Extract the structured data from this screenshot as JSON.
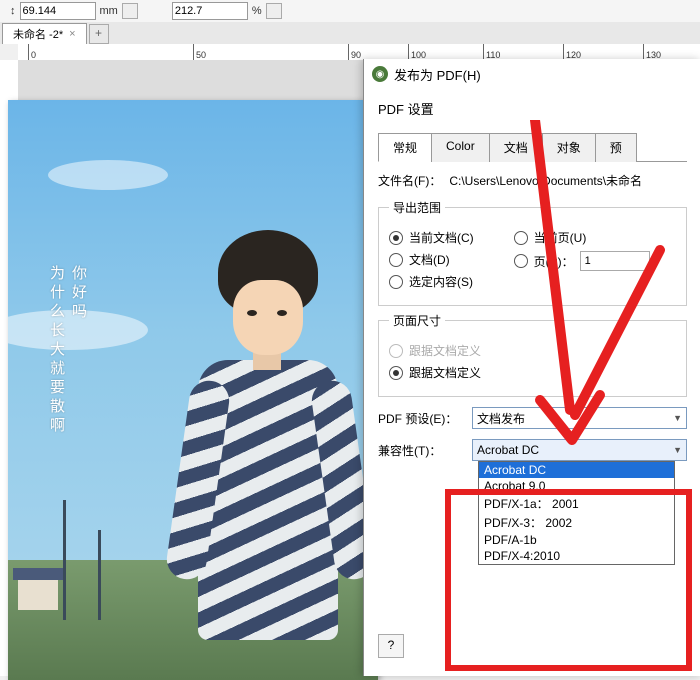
{
  "toolbar": {
    "coord_icon": "↕",
    "coord_value": "69.144",
    "unit": "mm",
    "zoom": "212.7",
    "pct": "%"
  },
  "doc_tab": {
    "name": "未命名 -2*"
  },
  "ruler": {
    "ticks": [
      "0",
      "50",
      "90",
      "100",
      "110",
      "120",
      "130"
    ]
  },
  "canvas_text": {
    "col1": "你好吗",
    "col2": "为什么长大就要散啊"
  },
  "dialog": {
    "title": "发布为 PDF(H)",
    "section": "PDF 设置",
    "tabs": [
      "常规",
      "Color",
      "文档",
      "对象",
      "预"
    ],
    "filename_label": "文件名(F)：",
    "filename_value": "C:\\Users\\Lenovo\\Documents\\未命名",
    "export_range": "导出范围",
    "r_current_doc": "当前文档(C)",
    "r_current_page": "当前页(U)",
    "r_docs": "文档(D)",
    "r_page": "页(P)：",
    "page_val": "1",
    "r_selection": "选定内容(S)",
    "page_size": "页面尺寸",
    "ps1": "跟据文档定义",
    "ps2": "跟据文档定义",
    "preset_label": "PDF 预设(E)：",
    "preset_value": "文档发布",
    "compat_label": "兼容性(T)：",
    "compat_value": "Acrobat DC",
    "compat_options": [
      "Acrobat DC",
      "Acrobat 9.0",
      "PDF/X-1a： 2001",
      "PDF/X-3： 2002",
      "PDF/A-1b",
      "PDF/X-4:2010"
    ],
    "help": "?"
  }
}
